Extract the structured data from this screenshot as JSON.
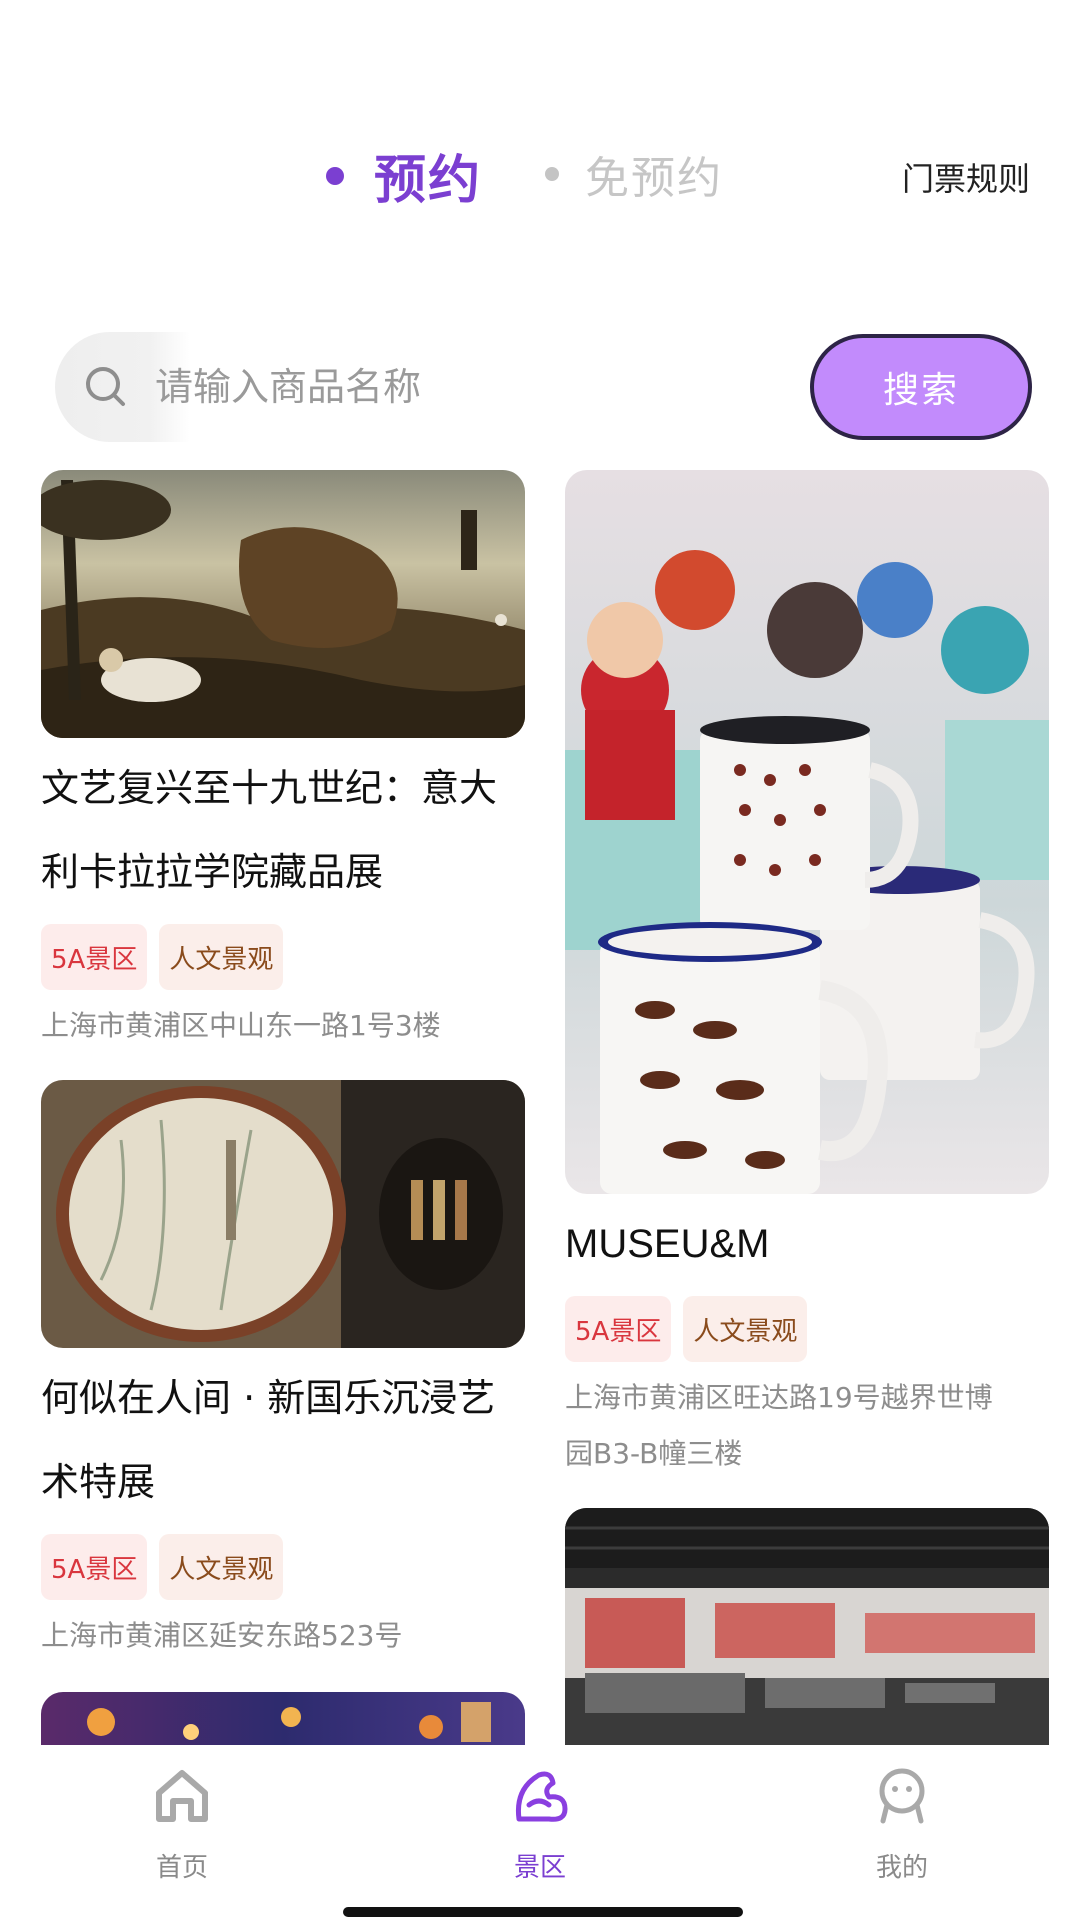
{
  "header": {
    "tabs": [
      {
        "label": "预约",
        "active": true
      },
      {
        "label": "免预约",
        "active": false
      }
    ],
    "ticket_rules": "门票规则"
  },
  "search": {
    "placeholder": "请输入商品名称",
    "value": "",
    "button": "搜索"
  },
  "feed": {
    "left": [
      {
        "title_line1": "文艺复兴至十九世纪：意大",
        "title_line2": "利卡拉拉学院藏品展",
        "tags": [
          "5A景区",
          "人文景观"
        ],
        "address": "上海市黄浦区中山东一路1号3楼"
      },
      {
        "title_line1": "何似在人间 · 新国乐沉浸艺",
        "title_line2": "术特展",
        "tags": [
          "5A景区",
          "人文景观"
        ],
        "address": "上海市黄浦区延安东路523号"
      },
      {
        "title_line1": "",
        "title_line2": "",
        "tags": [],
        "address": ""
      }
    ],
    "right": [
      {
        "title": "MUSEU&M",
        "tags": [
          "5A景区",
          "人文景观"
        ],
        "address_line1": "上海市黄浦区旺达路19号越界世博",
        "address_line2": "园B3-B幢三楼"
      },
      {
        "title": "",
        "tags": [],
        "address_line1": "",
        "address_line2": ""
      }
    ]
  },
  "nav": {
    "home": "首页",
    "scenic": "景区",
    "mine": "我的"
  },
  "colors": {
    "accent": "#7b3fd1",
    "search_button": "#c28bfc",
    "tag_5a": "#d9363e",
    "tag_culture": "#8a4b1c"
  },
  "icons": {
    "home": "home-icon",
    "scenic": "scenic-icon",
    "mine": "profile-icon",
    "search": "search-icon"
  }
}
